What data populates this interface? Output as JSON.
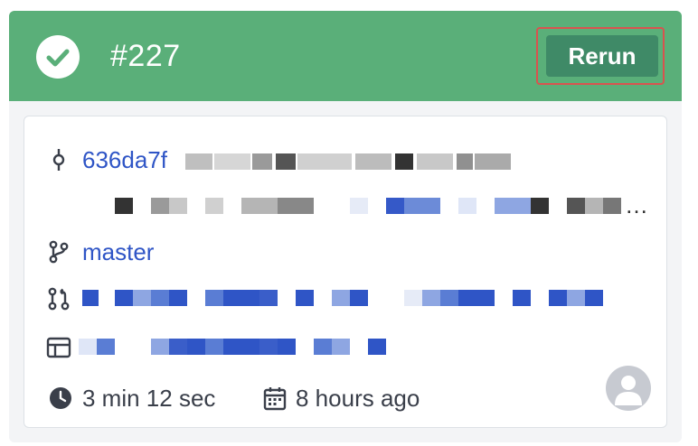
{
  "build": {
    "number": "#227",
    "status": "success",
    "rerun_label": "Rerun"
  },
  "commit": {
    "sha": "636da7f",
    "message_partial": "Merge ... /project-detail ..."
  },
  "branch": "master",
  "duration": "3 min 12 sec",
  "started": "8 hours ago",
  "colors": {
    "header_bg": "#5aaf79",
    "rerun_bg": "#3f8a67",
    "rerun_outline": "#d9534f",
    "link": "#2f55c6"
  },
  "icons": {
    "status": "check-circle-icon",
    "commit": "git-commit-icon",
    "branch": "git-branch-icon",
    "pull_request": "git-pull-request-icon",
    "pipeline": "layout-icon",
    "duration": "clock-icon",
    "started": "calendar-icon",
    "author": "user-avatar-icon"
  }
}
